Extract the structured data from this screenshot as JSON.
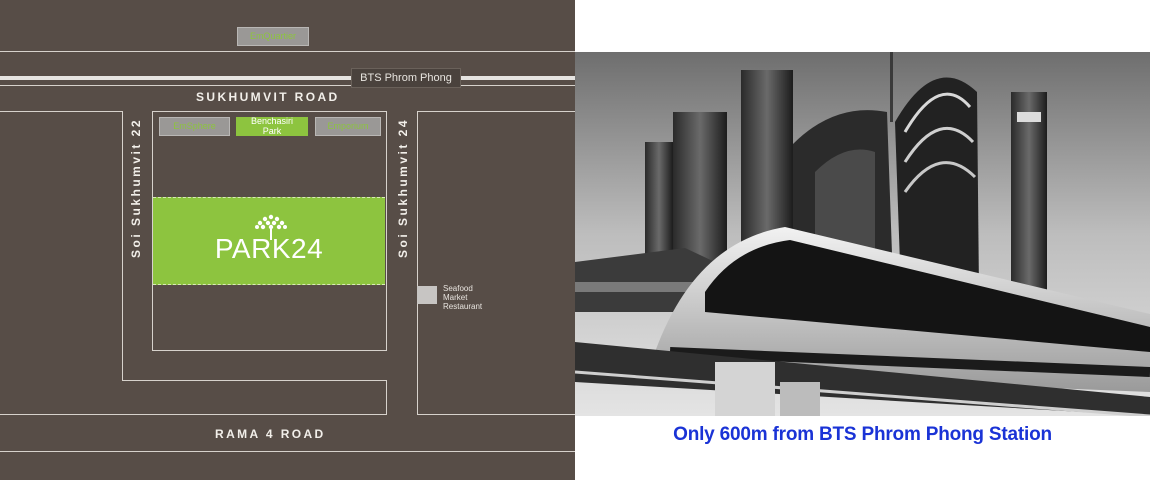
{
  "colors": {
    "map_background": "#574d47",
    "green": "#8dc43f",
    "caption": "#1a33d6"
  },
  "map": {
    "landmarks": {
      "emquartier": "EmQuartier",
      "emsphere": "EmSphere",
      "benchasiri_park_line1": "Benchasiri",
      "benchasiri_park_line2": "Park",
      "emporium": "Emporium"
    },
    "station": "BTS Phrom Phong",
    "roads": {
      "sukhumvit": "SUKHUMVIT ROAD",
      "rama4": "RAMA 4 ROAD",
      "soi22": "Soi Sukhumvit 22",
      "soi24": "Soi Sukhumvit 24"
    },
    "project_name": "PARK24",
    "seafood": {
      "line1": "Seafood",
      "line2": "Market",
      "line3": "Restaurant"
    }
  },
  "photo": {
    "caption": "Only 600m from BTS Phrom Phong Station",
    "icon": "skytrain-photo"
  }
}
